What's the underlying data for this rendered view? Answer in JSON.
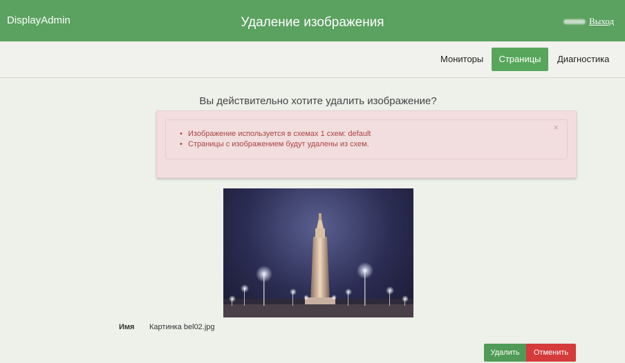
{
  "header": {
    "brand": "DisplayAdmin",
    "title": "Удаление изображения",
    "logout": "Выход"
  },
  "nav": {
    "items": [
      "Мониторы",
      "Страницы",
      "Диагностика"
    ],
    "active": "Страницы"
  },
  "dialog": {
    "question": "Вы действительно хотите удалить изображение?",
    "warnings": [
      "Изображение используется в схемах 1 схем: default",
      "Страницы с изображением будут удалены из схем."
    ],
    "close": "×"
  },
  "image": {
    "name_label": "Имя",
    "name_value": "Картинка bel02.jpg"
  },
  "actions": {
    "delete": "Удалить",
    "cancel": "Отменить"
  },
  "colors": {
    "header": "#5ba160",
    "active_nav": "#58a65c",
    "delete_button": "#4f9b57",
    "cancel_button": "#d63b3b",
    "alert_bg": "#f2dede"
  }
}
